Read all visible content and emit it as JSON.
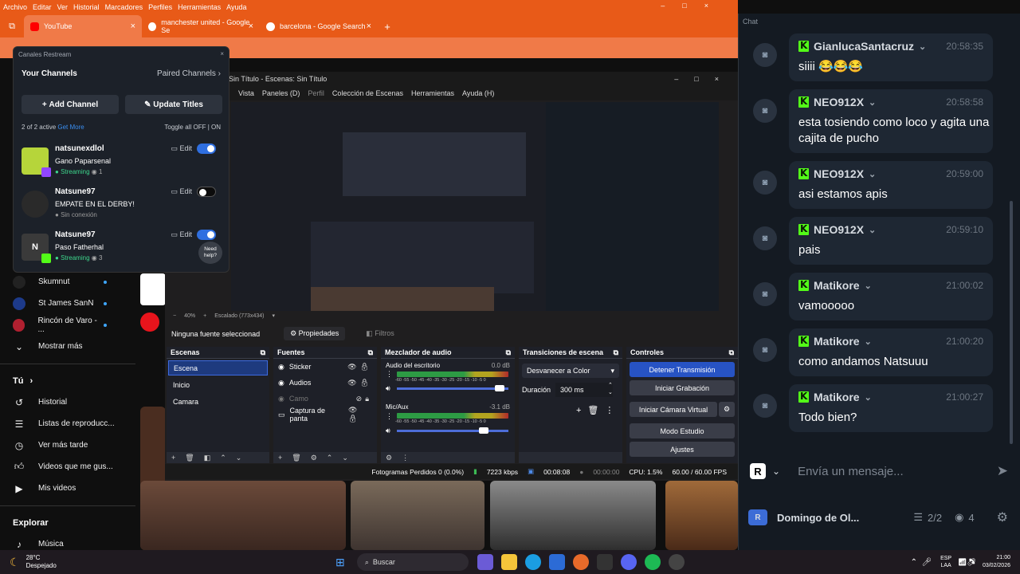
{
  "browser": {
    "menu": [
      "Archivo",
      "Editar",
      "Ver",
      "Historial",
      "Marcadores",
      "Perfiles",
      "Herramientas",
      "Ayuda"
    ],
    "tabs": [
      {
        "label": "YouTube",
        "close": "×"
      },
      {
        "label": "manchester united - Google Se",
        "close": "×"
      },
      {
        "label": "barcelona - Google Search",
        "close": "×"
      }
    ],
    "new_tab": "+"
  },
  "youtube": {
    "subs": [
      {
        "name": "Skumnut"
      },
      {
        "name": "St James SanN"
      },
      {
        "name": "Rincón de Varo - ..."
      }
    ],
    "show_more": "Mostrar más",
    "you_section": "Tú",
    "you_items": [
      "Historial",
      "Listas de reproducc...",
      "Ver más tarde",
      "Videos que me gus...",
      "Mis videos"
    ],
    "explore_section": "Explorar",
    "explore_items": [
      "Música"
    ]
  },
  "restream": {
    "window_title": "Canales Restream",
    "your_channels": "Your Channels",
    "paired_channels": "Paired Channels",
    "add_channel": "Add Channel",
    "update_titles": "Update Titles",
    "active_count": "2 of 2 active",
    "get_more": "Get More",
    "toggle_all": "Toggle all",
    "off": "OFF",
    "on": "ON",
    "edit": "Edit",
    "need_help": "Need help?",
    "channels": [
      {
        "name": "natsunexdlol",
        "title": "Gano Paparsenal",
        "status": "Streaming",
        "viewers": "1",
        "enabled": true
      },
      {
        "name": "Natsune97",
        "title": "EMPATE EN EL DERBY!",
        "status": "Sin conexión",
        "viewers": "",
        "enabled": false
      },
      {
        "name": "Natsune97",
        "title": "Paso Fatherhal",
        "status": "Streaming",
        "viewers": "3",
        "enabled": true
      }
    ]
  },
  "obs": {
    "title": "Sin Título - Escenas: Sin Título",
    "menu": [
      "Vista",
      "Paneles (D)",
      "Perfil",
      "Colección de Escenas",
      "Herramientas",
      "Ayuda (H)"
    ],
    "zoom": "40%",
    "scaled": "Escalado (773x434)",
    "no_source": "Ninguna fuente seleccionad",
    "properties": "Propiedades",
    "filters": "Filtros",
    "scenes_title": "Escenas",
    "scenes": [
      "Escena",
      "Inicio",
      "Camara"
    ],
    "sources_title": "Fuentes",
    "sources": [
      "Sticker",
      "Audios",
      "Camo",
      "Captura de panta"
    ],
    "mixer_title": "Mezclador de audio",
    "mixer": [
      {
        "name": "Audio del escritorio",
        "db": "0.0 dB",
        "level": 0.92
      },
      {
        "name": "Mic/Aux",
        "db": "-3.1 dB",
        "level": 0.78
      }
    ],
    "mixer_scale": "-60 -55 -50 -45 -40 -35 -30 -25 -20 -15 -10 -5 0",
    "transitions_title": "Transiciones de escena",
    "transition": "Desvanecer a Color",
    "duration_label": "Duración",
    "duration": "300 ms",
    "controls_title": "Controles",
    "controls": [
      "Detener Transmisión",
      "Iniciar Grabación",
      "Iniciar Cámara Virtual",
      "Modo Estudio",
      "Ajustes"
    ],
    "status": {
      "dropped": "Fotogramas Perdidos 0 (0.0%)",
      "bitrate": "7223 kbps",
      "stream_time": "00:08:08",
      "rec_time": "00:00:00",
      "cpu": "CPU: 1.5%",
      "fps": "60.00 / 60.00 FPS"
    }
  },
  "chat": {
    "title": "Chat",
    "messages": [
      {
        "user": "GianlucaSantacruz",
        "time": "20:58:35",
        "text": "siiii 😂😂😂"
      },
      {
        "user": "NEO912X",
        "time": "20:58:58",
        "text": "esta tosiendo como loco y agita una cajita de pucho"
      },
      {
        "user": "NEO912X",
        "time": "20:59:00",
        "text": "asi estamos apis"
      },
      {
        "user": "NEO912X",
        "time": "20:59:10",
        "text": "pais"
      },
      {
        "user": "Matikore",
        "time": "21:00:02",
        "text": "vamooooo"
      },
      {
        "user": "Matikore",
        "time": "21:00:20",
        "text": "como andamos Natsuuu"
      },
      {
        "user": "Matikore",
        "time": "21:00:27",
        "text": "Todo bien?"
      }
    ],
    "input_placeholder": "Envía un mensaje...",
    "show_name": "Domingo de Ol...",
    "channels_count": "2/2",
    "viewers": "4"
  },
  "taskbar": {
    "weather_temp": "28°C",
    "weather_desc": "Despejado",
    "search": "Buscar",
    "lang": "ESP",
    "lang2": "LAA",
    "time": "21:00",
    "date": "03/02/2026"
  },
  "colors": {
    "brand_orange": "#e85a18",
    "kick_green": "#53fc18",
    "obs_blue": "#2753c4",
    "toggle_blue": "#2f6fe0"
  }
}
